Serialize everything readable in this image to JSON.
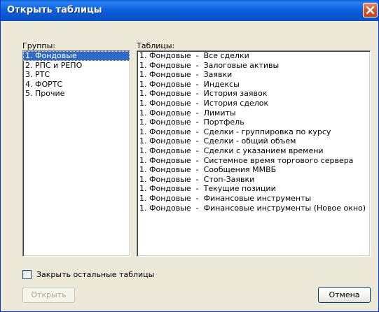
{
  "window": {
    "title": "Открыть таблицы",
    "close_icon": "close-icon"
  },
  "groups": {
    "label": "Группы:",
    "items": [
      {
        "label": "1. Фондовые",
        "selected": true
      },
      {
        "label": "2. РПС и РЕПО",
        "selected": false
      },
      {
        "label": "3. РТС",
        "selected": false
      },
      {
        "label": "4. ФОРТС",
        "selected": false
      },
      {
        "label": "5. Прочие",
        "selected": false
      }
    ]
  },
  "tables": {
    "label": "Таблицы:",
    "items": [
      "1. Фондовые  -  Все сделки",
      "1. Фондовые  -  Залоговые активы",
      "1. Фондовые  -  Заявки",
      "1. Фондовые  -  Индексы",
      "1. Фондовые  -  История заявок",
      "1. Фондовые  -  История сделок",
      "1. Фондовые  -  Лимиты",
      "1. Фондовые  -  Портфель",
      "1. Фондовые  -  Сделки - группировка по курсу",
      "1. Фондовые  -  Сделки - общий объем",
      "1. Фондовые  -  Сделки с указанием времени",
      "1. Фондовые  -  Системное время торгового сервера",
      "1. Фондовые  -  Сообщения ММВБ",
      "1. Фондовые  -  Стоп-Заявки",
      "1. Фондовые  -  Текущие позиции",
      "1. Фондовые  -  Финансовые инструменты",
      "1. Фондовые  -  Финансовые инструменты (Новое окно)"
    ]
  },
  "close_others": {
    "label": "Закрыть остальные таблицы",
    "checked": false
  },
  "buttons": {
    "open_label": "Открыть",
    "open_enabled": false,
    "cancel_label": "Отмена"
  },
  "colors": {
    "title_bar": "#0a5dd8",
    "selection": "#316ac5",
    "dialog_bg": "#ece9d8"
  }
}
